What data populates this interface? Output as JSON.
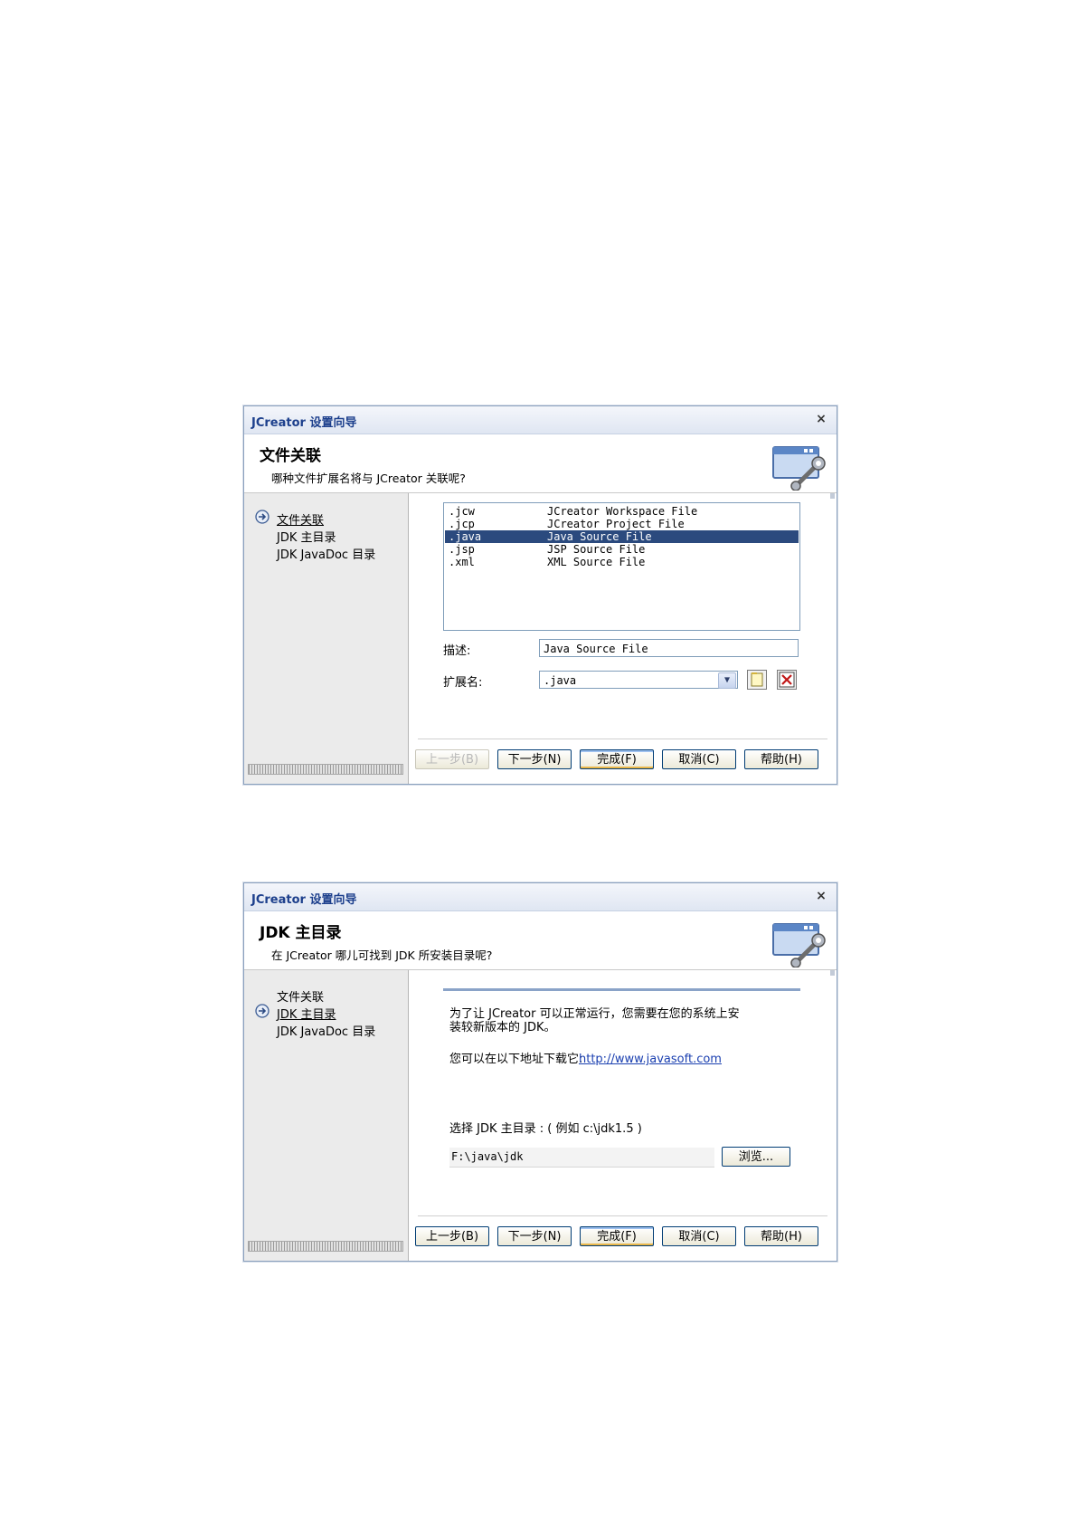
{
  "dialog1": {
    "title": "JCreator 设置向导",
    "close_glyph": "×",
    "header_title": "文件关联",
    "header_subtitle": "哪种文件扩展名将与 JCreator 关联呢?",
    "nav": [
      "文件关联",
      "JDK 主目录",
      "JDK JavaDoc 目录"
    ],
    "active_nav": 0,
    "file_list": [
      {
        "ext": ".jcw",
        "desc": "JCreator Workspace File"
      },
      {
        "ext": ".jcp",
        "desc": "JCreator Project File"
      },
      {
        "ext": ".java",
        "desc": "Java Source File",
        "selected": true
      },
      {
        "ext": ".jsp",
        "desc": "JSP Source File"
      },
      {
        "ext": ".xml",
        "desc": "XML Source File"
      }
    ],
    "desc_label": "描述:",
    "desc_value": "Java Source File",
    "ext_label": "扩展名:",
    "ext_value": ".java",
    "buttons": {
      "back": "上一步(B)",
      "next": "下一步(N)",
      "finish": "完成(F)",
      "cancel": "取消(C)",
      "help": "帮助(H)"
    },
    "back_enabled": false
  },
  "dialog2": {
    "title": "JCreator 设置向导",
    "close_glyph": "×",
    "header_title": "JDK 主目录",
    "header_subtitle": "在 JCreator 哪儿可找到 JDK 所安装目录呢?",
    "nav": [
      "文件关联",
      "JDK 主目录",
      "JDK JavaDoc 目录"
    ],
    "active_nav": 1,
    "para1_line1": "为了让 JCreator 可以正常运行，您需要在您的系统上安",
    "para1_line2": "装较新版本的 JDK。",
    "download_text": "您可以在以下地址下载它:",
    "download_link": "http://www.javasoft.com",
    "choose_label": "选择 JDK 主目录 : ( 例如 c:\\jdk1.5 )",
    "path_value": "F:\\java\\jdk",
    "browse_label": "浏览...",
    "buttons": {
      "back": "上一步(B)",
      "next": "下一步(N)",
      "finish": "完成(F)",
      "cancel": "取消(C)",
      "help": "帮助(H)"
    },
    "back_enabled": true
  },
  "icons": {
    "title_close": "close-icon",
    "wizard": "wizard-settings-icon",
    "nav_current": "arrow-right-circle-icon",
    "combo": "chevron-down-icon",
    "new_ext": "new-document-icon",
    "delete_ext": "delete-x-icon"
  },
  "colors": {
    "title_text": "#1c3f8c",
    "selection": "#2b4a7e",
    "link": "#1a3fb0"
  }
}
